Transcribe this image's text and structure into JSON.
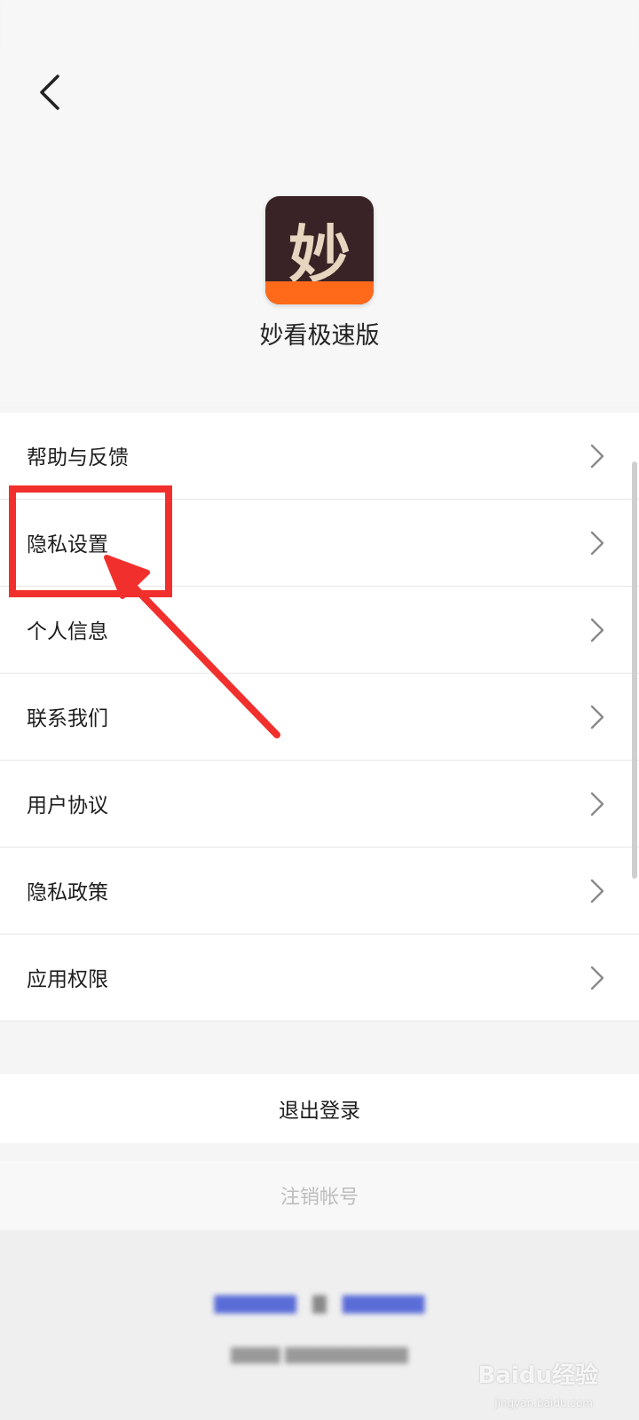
{
  "header": {
    "app_name": "妙看极速版",
    "logo_glyph": "妙"
  },
  "menu": {
    "items": [
      {
        "label": "帮助与反馈"
      },
      {
        "label": "隐私设置"
      },
      {
        "label": "个人信息"
      },
      {
        "label": "联系我们"
      },
      {
        "label": "用户协议"
      },
      {
        "label": "隐私政策"
      },
      {
        "label": "应用权限"
      }
    ]
  },
  "actions": {
    "logout_label": "退出登录",
    "cancel_account_label": "注销帐号"
  },
  "watermark": {
    "brand": "Baidu经验",
    "url": "jingyan.baidu.com"
  },
  "colors": {
    "annotation": "#f1302d",
    "logo_band": "#ff6a1a",
    "logo_bg": "#3a2326"
  },
  "icons": {
    "back": "chevron-left-icon",
    "menu_item": "chevron-right-icon"
  }
}
